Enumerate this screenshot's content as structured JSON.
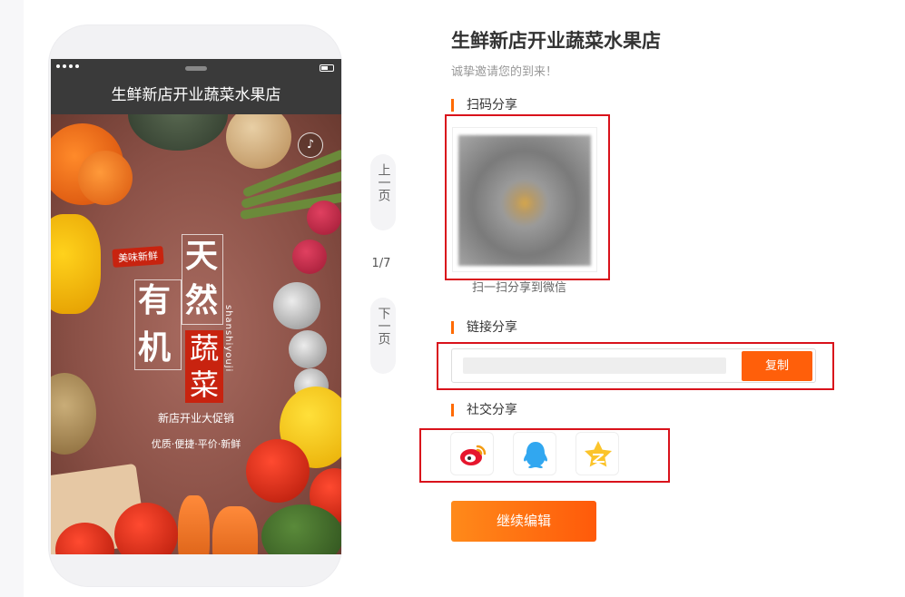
{
  "poster": {
    "app_title": "生鲜新店开业蔬菜水果店",
    "tag": "美味新鲜",
    "char_tian": "天",
    "char_ran": "然",
    "char_you": "有",
    "char_ji": "机",
    "shucai": "蔬菜",
    "side_text": "shanshiyouji",
    "line1": "新店开业大促销",
    "line2": "优质·便捷·平价·新鲜",
    "music_icon": "music-note-icon"
  },
  "pager": {
    "prev": "上一页",
    "next": "下一页",
    "current": "1/7"
  },
  "panel": {
    "title": "生鲜新店开业蔬菜水果店",
    "subtitle": "诚挚邀请您的到来！",
    "qr_section": "扫码分享",
    "qr_caption": "扫一扫分享到微信",
    "link_section": "链接分享",
    "copy_label": "复制",
    "social_section": "社交分享",
    "social_icons": [
      "weibo-icon",
      "qq-icon",
      "qzone-icon"
    ],
    "continue_label": "继续编辑"
  },
  "colors": {
    "accent": "#ff6a00",
    "highlight_border": "#d9121b",
    "phone_header": "#3a3a3a"
  }
}
